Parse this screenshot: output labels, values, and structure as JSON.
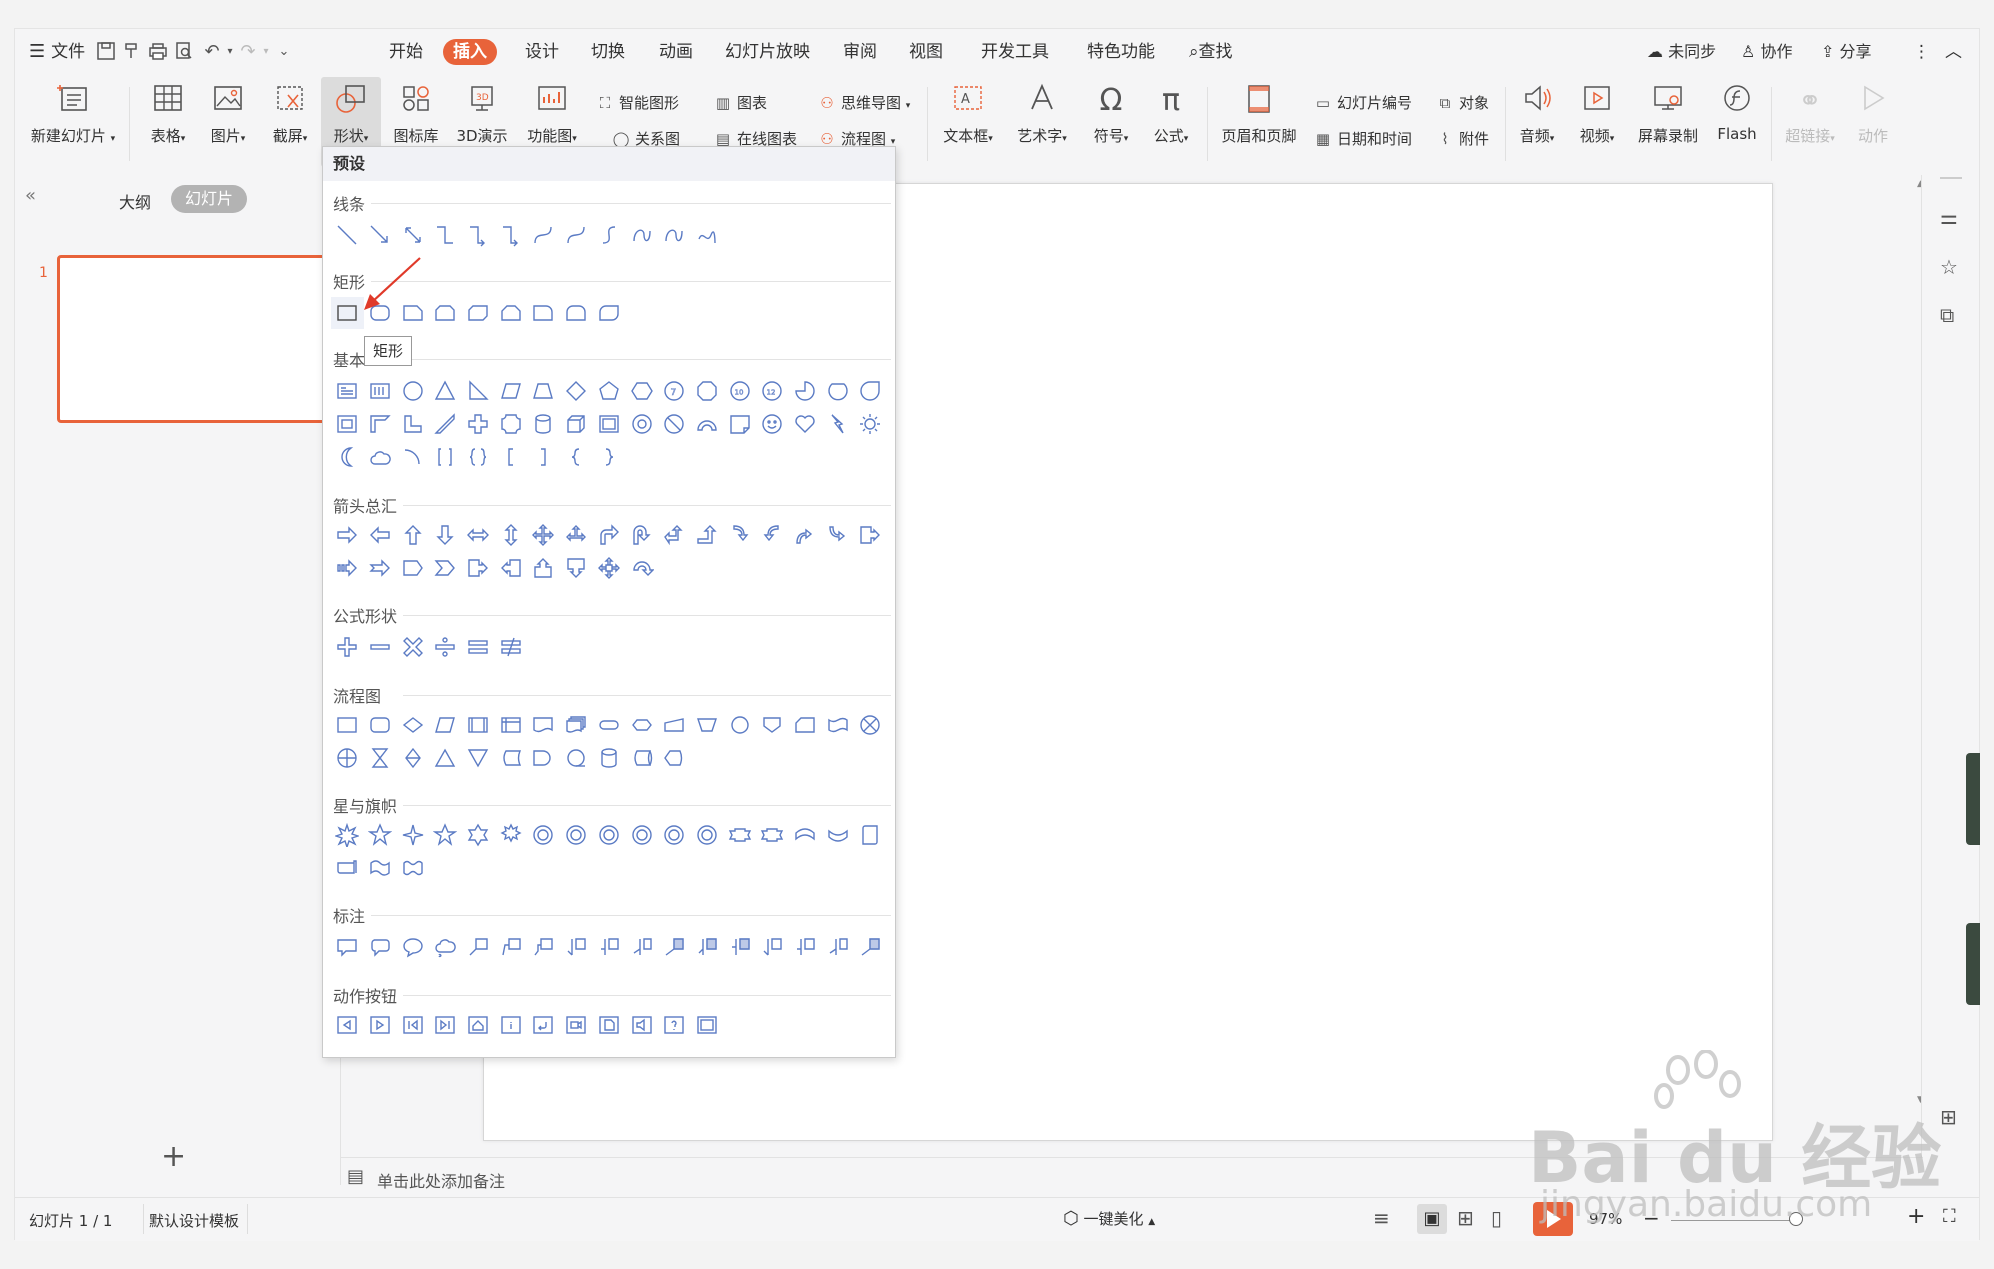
{
  "menu": {
    "file": "文件",
    "tabs": [
      "开始",
      "插入",
      "设计",
      "切换",
      "动画",
      "幻灯片放映",
      "审阅",
      "视图",
      "开发工具",
      "特色功能"
    ],
    "active_tab": "插入",
    "search": "查找",
    "sync": "未同步",
    "collab": "协作",
    "share": "分享"
  },
  "ribbon": {
    "new_slide": "新建幻灯片",
    "table": "表格",
    "picture": "图片",
    "screenshot": "截屏",
    "shape": "形状",
    "icon_lib": "图标库",
    "3d": "3D演示",
    "func_chart": "功能图",
    "smart_art": "智能图形",
    "chart": "图表",
    "mindmap": "思维导图",
    "relation": "关系图",
    "online_chart": "在线图表",
    "flowchart": "流程图",
    "textbox": "文本框",
    "wordart": "艺术字",
    "symbol": "符号",
    "formula": "公式",
    "header_footer": "页眉和页脚",
    "slide_number": "幻灯片编号",
    "object": "对象",
    "datetime": "日期和时间",
    "attachment": "附件",
    "audio": "音频",
    "video": "视频",
    "screen_record": "屏幕录制",
    "flash": "Flash",
    "hyperlink": "超链接",
    "action": "动作"
  },
  "left_panel": {
    "tab_outline": "大纲",
    "tab_slides": "幻灯片",
    "slide_number": "1",
    "add": "+"
  },
  "shapes_panel": {
    "header": "预设",
    "categories": {
      "lines": "线条",
      "rect": "矩形",
      "basic": "基本",
      "arrows": "箭头总汇",
      "formula": "公式形状",
      "flow": "流程图",
      "stars": "星与旗帜",
      "callout": "标注",
      "action": "动作按钮"
    },
    "tooltip": "矩形"
  },
  "notes": {
    "placeholder": "单击此处添加备注"
  },
  "status": {
    "slide_info": "幻灯片 1 / 1",
    "template": "默认设计模板",
    "beautify": "一键美化",
    "zoom": "97%"
  },
  "watermark": {
    "brand": "Bai du 经验",
    "url": "jingyan.baidu.com"
  },
  "colors": {
    "accent": "#e8633a",
    "shape_stroke": "#5b7bc4"
  }
}
